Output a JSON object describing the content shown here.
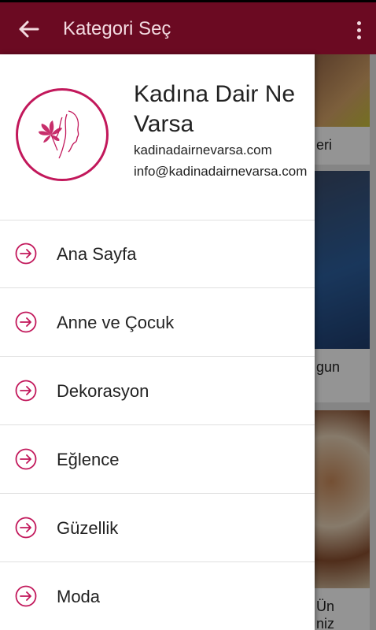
{
  "appbar": {
    "title": "Kategori Seç",
    "back_icon": "arrow-left-icon",
    "overflow_icon": "more-vert-icon",
    "color": "#6b0a22"
  },
  "background_cards": [
    {
      "caption": "eri"
    },
    {
      "caption": "gun"
    },
    {
      "caption": "Ün\nniz"
    }
  ],
  "drawer": {
    "site_name": "Kadına Dair Ne Varsa",
    "site_url": "kadinadairnevarsa.com",
    "site_email": "info@kadinadairnevarsa.com",
    "accent_color": "#c2185b",
    "items": [
      {
        "label": "Ana Sayfa",
        "icon": "arrow-circle-right-icon"
      },
      {
        "label": "Anne ve Çocuk",
        "icon": "arrow-circle-right-icon"
      },
      {
        "label": "Dekorasyon",
        "icon": "arrow-circle-right-icon"
      },
      {
        "label": "Eğlence",
        "icon": "arrow-circle-right-icon"
      },
      {
        "label": "Güzellik",
        "icon": "arrow-circle-right-icon"
      },
      {
        "label": "Moda",
        "icon": "arrow-circle-right-icon"
      }
    ]
  }
}
